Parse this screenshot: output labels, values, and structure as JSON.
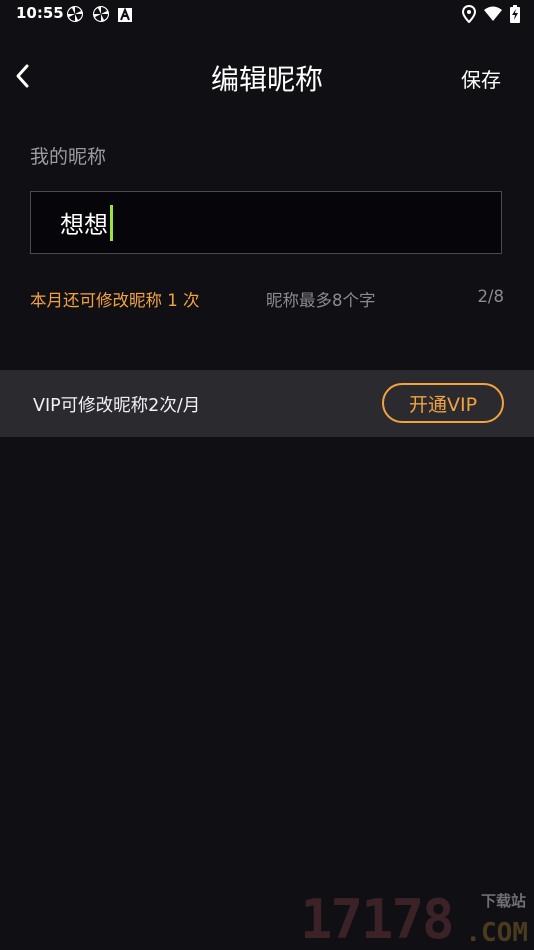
{
  "status_bar": {
    "time": "10:55",
    "left_icons": [
      "pinwheel-icon",
      "pinwheel-icon",
      "a-app-icon"
    ],
    "right_icons": [
      "location-icon",
      "wifi-icon",
      "battery-charging-icon"
    ]
  },
  "header": {
    "back_icon": "chevron-left-icon",
    "title": "编辑昵称",
    "save_label": "保存"
  },
  "nickname_section": {
    "label": "我的昵称",
    "input_value": "想想",
    "remaining_changes": "本月还可修改昵称 1 次",
    "limit_hint": "昵称最多8个字",
    "char_count": "2/8"
  },
  "vip_banner": {
    "text": "VIP可修改昵称2次/月",
    "button_label": "开通VIP"
  },
  "watermark": {
    "number": "17178",
    "download_label": "下载站",
    "domain": ".COM"
  },
  "colors": {
    "background": "#100f14",
    "accent_orange": "#f2a340",
    "caret_green": "#9be23c",
    "vip_bar": "#2b2b2f"
  }
}
